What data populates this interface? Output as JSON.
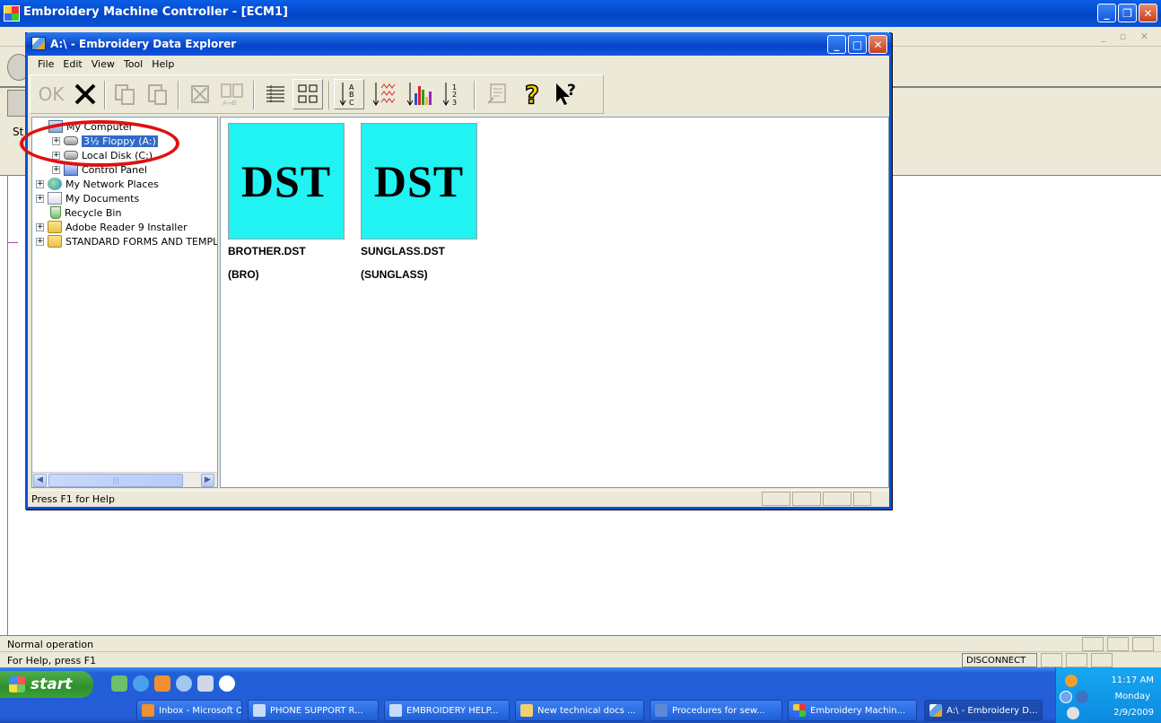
{
  "app": {
    "title": "Embroidery Machine Controller - [ECM1]",
    "stub_label": "St",
    "status_text": "Normal operation",
    "help_text": "For Help, press F1",
    "connection_status": "DISCONNECT"
  },
  "explorer": {
    "title": "A:\\ - Embroidery Data Explorer",
    "menu": [
      "File",
      "Edit",
      "View",
      "Tool",
      "Help"
    ],
    "toolbar": {
      "ok_label": "OK",
      "buttons": [
        "ok-button",
        "delete-button",
        "copy-button",
        "paste-button",
        "clear-button",
        "compare-button",
        "details-view-button",
        "large-icons-button",
        "sort-name-button",
        "sort-stitch-button",
        "sort-color-button",
        "sort-number-button",
        "properties-button",
        "help-button",
        "context-help-button"
      ]
    },
    "tree": {
      "items": [
        {
          "label": "My Computer",
          "icon": "computer-icon"
        },
        {
          "label": "3½ Floppy (A:)",
          "icon": "floppy-drive-icon",
          "selected": true
        },
        {
          "label": "Local Disk (C:)",
          "icon": "hard-drive-icon"
        },
        {
          "label": "Control Panel",
          "icon": "control-panel-icon"
        },
        {
          "label": "My Network Places",
          "icon": "network-icon"
        },
        {
          "label": "My Documents",
          "icon": "documents-icon"
        },
        {
          "label": "Recycle Bin",
          "icon": "recycle-bin-icon"
        },
        {
          "label": "Adobe Reader 9 Installer",
          "icon": "folder-icon"
        },
        {
          "label": "STANDARD FORMS AND TEMPLAT",
          "icon": "folder-icon"
        }
      ]
    },
    "files": [
      {
        "thumb_text": "DST",
        "name": "BROTHER.DST",
        "desc": "(BRO)"
      },
      {
        "thumb_text": "DST",
        "name": "SUNGLASS.DST",
        "desc": "(SUNGLASS)"
      }
    ],
    "status_text": "Press F1 for Help"
  },
  "taskbar": {
    "start_label": "start",
    "tasks": [
      {
        "label": "Inbox - Microsoft O..."
      },
      {
        "label": "PHONE SUPPORT R..."
      },
      {
        "label": "EMBROIDERY HELP..."
      },
      {
        "label": "New technical docs ..."
      },
      {
        "label": "Procedures for sew..."
      },
      {
        "label": "Embroidery Machin..."
      },
      {
        "label": "A:\\ - Embroidery D...",
        "active": true
      }
    ],
    "clock": {
      "time": "11:17 AM",
      "day": "Monday",
      "date": "2/9/2009"
    }
  },
  "colors": {
    "thumbnail": "#21f2f2",
    "highlight_ring": "#e01010",
    "titlebar": "#0346c7",
    "selection": "#316ac5"
  }
}
